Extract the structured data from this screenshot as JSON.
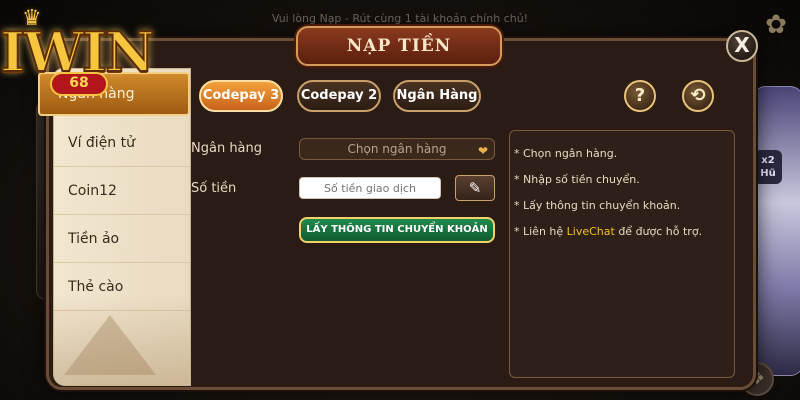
{
  "notice": "Vui lòng Nạp - Rút cùng 1 tài khoản chính chủ!",
  "logo": {
    "text": "IWIN",
    "sub": "68"
  },
  "modal": {
    "title": "NẠP TIỀN",
    "close_label": "X"
  },
  "side_menu": {
    "items": [
      {
        "label": "Ngân hàng"
      },
      {
        "label": "Ví điện tử"
      },
      {
        "label": "Coin12"
      },
      {
        "label": "Tiền ảo"
      },
      {
        "label": "Thẻ cào"
      }
    ]
  },
  "tabs": [
    {
      "label": "Codepay 3"
    },
    {
      "label": "Codepay 2"
    },
    {
      "label": "Ngân Hàng"
    }
  ],
  "header_buttons": {
    "help_label": "?",
    "history_label": "⟲"
  },
  "form": {
    "bank_label": "Ngân hàng",
    "bank_select_value": "Chọn ngân hàng",
    "amount_label": "Số tiền",
    "amount_placeholder": "Số tiền giao dịch",
    "edit_label": "✎",
    "submit_label": "LẤY THÔNG TIN CHUYỂN KHOẢN"
  },
  "hints": {
    "line1": "* Chọn ngân hàng.",
    "line2": "* Nhập số tiền chuyển.",
    "line3": "* Lấy thông tin chuyển khoản.",
    "line4_pre": "* Liên hệ ",
    "line4_link": "LiveChat",
    "line4_post": " để được hỗ trợ."
  },
  "background": {
    "badge": "x2\nHũ"
  },
  "colors": {
    "accent_orange": "#f3a13c",
    "accent_green": "#1f8a4e",
    "gold": "#f2c02e",
    "panel_dark": "#2a1c14"
  }
}
